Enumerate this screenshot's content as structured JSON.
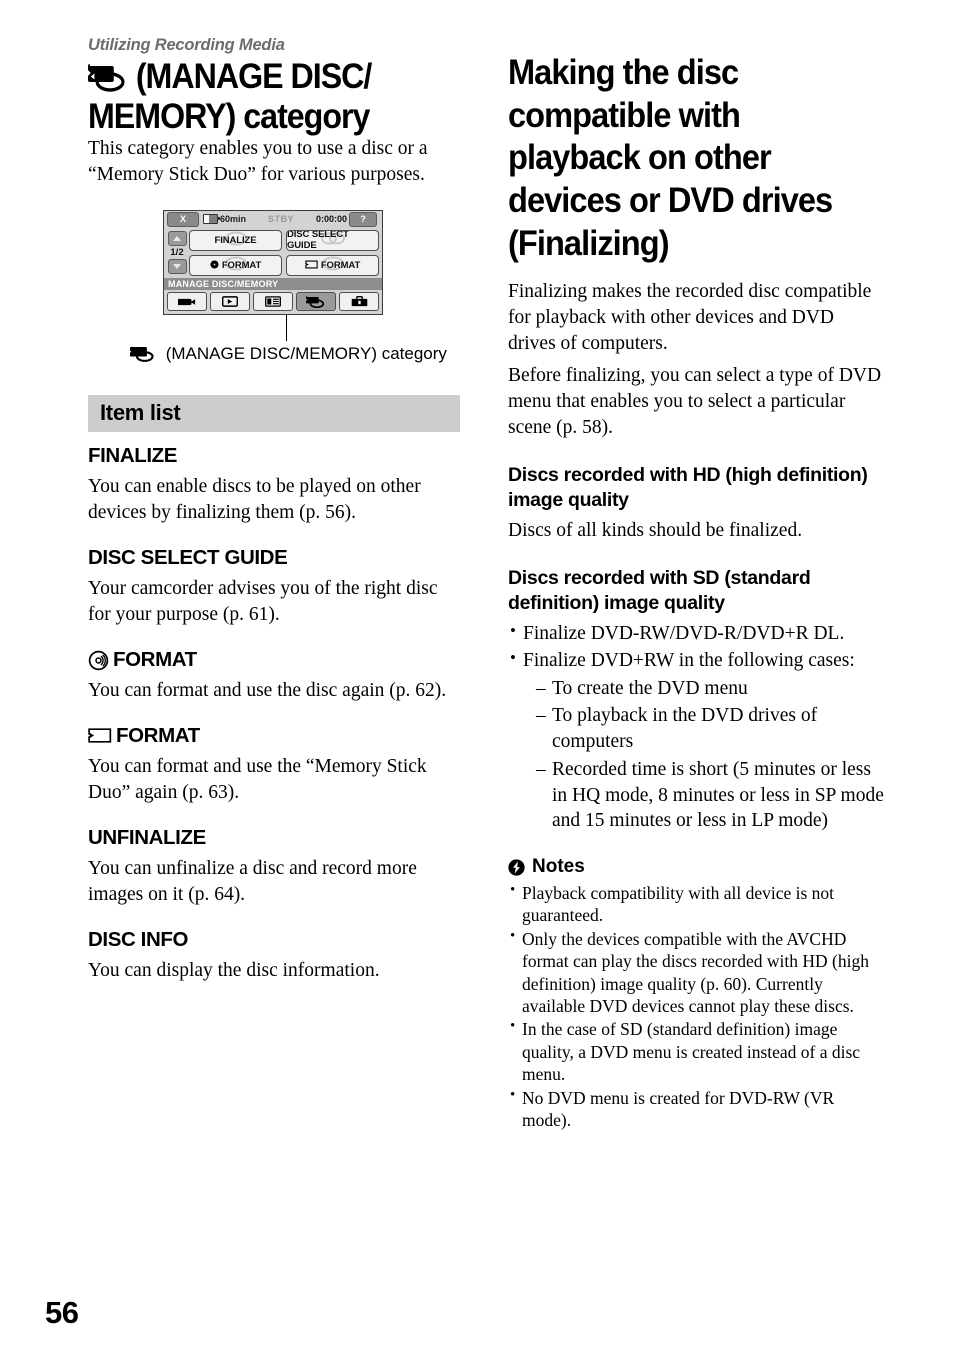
{
  "running_head": "Utilizing Recording Media",
  "page_number": "56",
  "left": {
    "title_text": "(MANAGE DISC/ MEMORY) category",
    "title_icon": "disc-memory-icon",
    "intro": "This category enables you to use a disc or a “Memory Stick Duo” for various purposes.",
    "screen": {
      "topbar": {
        "close_label": "X",
        "battery_label": "60min",
        "status_label": "STBY",
        "timecode": "0:00:00",
        "help_label": "?"
      },
      "page_indicator": "1/2",
      "up_arrow": "▲",
      "down_arrow": "▼",
      "buttons": [
        {
          "label": "FINALIZE",
          "icon": "none"
        },
        {
          "label": "DISC SELECT GUIDE",
          "icon": "none"
        },
        {
          "label": "FORMAT",
          "icon": "disc-icon"
        },
        {
          "label": "FORMAT",
          "icon": "memory-stick-icon"
        }
      ],
      "footer_title": "MANAGE DISC/MEMORY",
      "tabs": [
        {
          "icon": "camera-icon",
          "selected": false
        },
        {
          "icon": "playback-icon",
          "selected": false
        },
        {
          "icon": "list-icon",
          "selected": false
        },
        {
          "icon": "manage-disc-memory-icon",
          "selected": true
        },
        {
          "icon": "toolbox-icon",
          "selected": false
        }
      ]
    },
    "screen_caption": "(MANAGE DISC/MEMORY) category",
    "item_list_band": "Item list",
    "items": [
      {
        "icon": "none",
        "heading": "FINALIZE",
        "body": "You can enable discs to be played on other devices by finalizing them (p. 56)."
      },
      {
        "icon": "none",
        "heading": "DISC SELECT GUIDE",
        "body": "Your camcorder advises you of the right disc for your purpose (p. 61)."
      },
      {
        "icon": "disc-icon",
        "heading": "FORMAT",
        "body": "You can format and use the disc again (p. 62)."
      },
      {
        "icon": "memory-stick-icon",
        "heading": "FORMAT",
        "body": "You can format and use the “Memory Stick Duo” again (p. 63)."
      },
      {
        "icon": "none",
        "heading": "UNFINALIZE",
        "body": "You can unfinalize a disc and record more images on it (p. 64)."
      },
      {
        "icon": "none",
        "heading": "DISC INFO",
        "body": "You can display the disc information."
      }
    ]
  },
  "right": {
    "title": "Making the disc compatible with playback on other devices or DVD drives (Finalizing)",
    "intro_p1": "Finalizing makes the recorded disc compatible for playback with other devices and DVD drives of computers.",
    "intro_p2": "Before finalizing, you can select a type of DVD menu that enables you to select a particular scene (p. 58).",
    "hd_heading": "Discs recorded with HD (high definition) image quality",
    "hd_body": "Discs of all kinds should be finalized.",
    "sd_heading": "Discs recorded with SD (standard definition) image quality",
    "sd_bullets": [
      "Finalize DVD-RW/DVD-R/DVD+R DL.",
      "Finalize DVD+RW in the following cases:"
    ],
    "sd_sub_bullets": [
      "To create the DVD menu",
      "To playback in the DVD drives of computers",
      "Recorded time is short (5 minutes or less in HQ mode, 8 minutes or less in SP mode and 15 minutes or less in LP mode)"
    ],
    "notes_heading": "Notes",
    "notes_icon": "note-flash-icon",
    "notes": [
      "Playback compatibility with all device is not guaranteed.",
      "Only the devices compatible with the AVCHD format can play the discs recorded with HD (high definition) image quality (p. 60). Currently available DVD devices cannot play these discs.",
      "In the case of SD (standard definition) image quality, a DVD menu is created instead of a disc menu.",
      "No DVD menu is created for DVD-RW (VR mode)."
    ]
  },
  "colors": {
    "band_bg": "#cdcdcd",
    "running_head": "#6d6d6d",
    "screen_bg": "#d3d3d3",
    "screen_footer": "#8d8d8d"
  }
}
